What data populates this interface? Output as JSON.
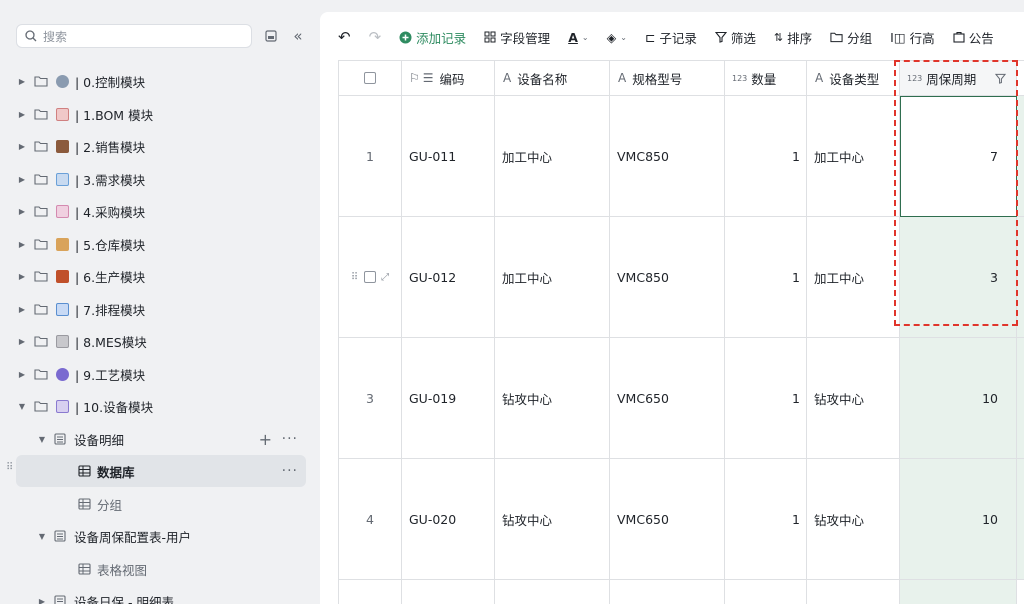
{
  "sidebar": {
    "search_placeholder": "搜索",
    "items": [
      {
        "label": "| 0.控制模块",
        "emoji_color": "#8a9bb0"
      },
      {
        "label": "| 1.BOM 模块",
        "emoji_color": "#e8a0a0"
      },
      {
        "label": "| 2.销售模块",
        "emoji_color": "#8b5a3c"
      },
      {
        "label": "| 3.需求模块",
        "emoji_color": "#6aa0d8"
      },
      {
        "label": "| 4.采购模块",
        "emoji_color": "#d48ab0"
      },
      {
        "label": "| 5.仓库模块",
        "emoji_color": "#d9a35a"
      },
      {
        "label": "| 6.生产模块",
        "emoji_color": "#c0502a"
      },
      {
        "label": "| 7.排程模块",
        "emoji_color": "#5a8fd0"
      },
      {
        "label": "| 8.MES模块",
        "emoji_color": "#9a9aa0"
      },
      {
        "label": "| 9.工艺模块",
        "emoji_color": "#7a6ad0"
      },
      {
        "label": "| 10.设备模块",
        "emoji_color": "#8a7ad0"
      }
    ],
    "sub": {
      "equip_detail": "设备明细",
      "database": "数据库",
      "group": "分组",
      "equip_config": "设备周保配置表-用户",
      "table_view": "表格视图",
      "daily_detail": "设备日保 - 明细表"
    }
  },
  "toolbar": {
    "add_record": "添加记录",
    "field_mgmt": "字段管理",
    "sub_record": "子记录",
    "filter": "筛选",
    "sort": "排序",
    "group": "分组",
    "row_height": "行高",
    "notice": "公告"
  },
  "table": {
    "headers": {
      "code": "编码",
      "name": "设备名称",
      "model": "规格型号",
      "qty": "数量",
      "type": "设备类型",
      "cycle": "周保周期"
    },
    "num_prefix": "123",
    "rows": [
      {
        "idx": "1",
        "code": "GU-011",
        "name": "加工中心",
        "model": "VMC850",
        "qty": "1",
        "type": "加工中心",
        "cycle": "7"
      },
      {
        "idx": "",
        "code": "GU-012",
        "name": "加工中心",
        "model": "VMC850",
        "qty": "1",
        "type": "加工中心",
        "cycle": "3"
      },
      {
        "idx": "3",
        "code": "GU-019",
        "name": "钻攻中心",
        "model": "VMC650",
        "qty": "1",
        "type": "钻攻中心",
        "cycle": "10"
      },
      {
        "idx": "4",
        "code": "GU-020",
        "name": "钻攻中心",
        "model": "VMC650",
        "qty": "1",
        "type": "钻攻中心",
        "cycle": "10"
      }
    ]
  },
  "colors": {
    "accent": "#2f8c61",
    "highlight": "#e0352b",
    "cycle_bg": "#e8f2ec"
  }
}
